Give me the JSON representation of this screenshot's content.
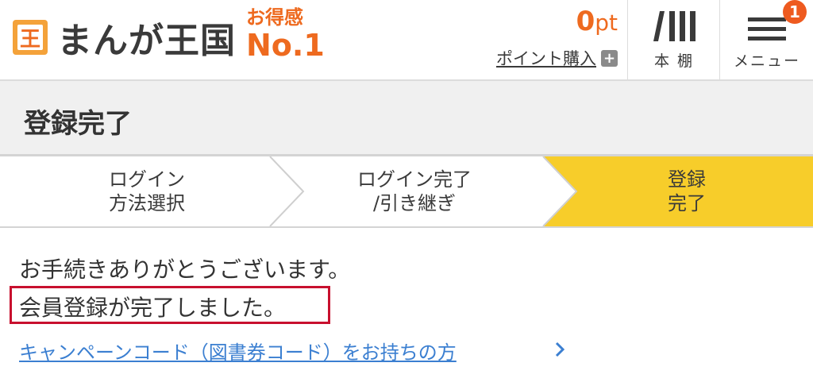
{
  "header": {
    "logo_text": "まんが王国",
    "promo_top": "お得感",
    "promo_big": "No.1",
    "points_value": "0",
    "points_unit": "pt",
    "points_buy_label": "ポイント購入",
    "bookshelf_label": "本 棚",
    "menu_label": "メニュー",
    "menu_badge": "1"
  },
  "page": {
    "title": "登録完了"
  },
  "steps": [
    {
      "label": "ログイン\n方法選択",
      "active": false
    },
    {
      "label": "ログイン完了\n/引き継ぎ",
      "active": false
    },
    {
      "label": "登録\n完了",
      "active": true
    }
  ],
  "body": {
    "thanks": "お手続きありがとうございます。",
    "complete": "会員登録が完了しました。",
    "campaign_link": "キャンペーンコード（図書券コード）をお持ちの方"
  },
  "colors": {
    "accent_orange": "#ee6a1f",
    "active_step": "#f7cd2a",
    "link_blue": "#3b7fd1",
    "highlight_red": "#c8102e"
  },
  "icons": [
    "logo-mark-icon",
    "plus-icon",
    "bookshelf-icon",
    "hamburger-icon",
    "chevron-right-icon"
  ]
}
